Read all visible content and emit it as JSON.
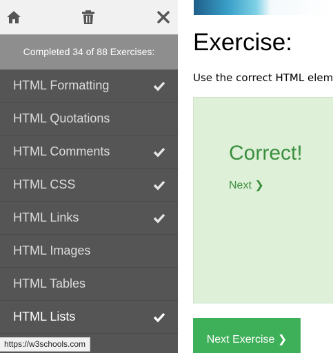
{
  "sidebar": {
    "progress_text": "Completed 34 of 88 Exercises:",
    "items": [
      {
        "label": "HTML Formatting",
        "checked": true
      },
      {
        "label": "HTML Quotations",
        "checked": false
      },
      {
        "label": "HTML Comments",
        "checked": true
      },
      {
        "label": "HTML CSS",
        "checked": true
      },
      {
        "label": "HTML Links",
        "checked": true
      },
      {
        "label": "HTML Images",
        "checked": false
      },
      {
        "label": "HTML Tables",
        "checked": false
      },
      {
        "label": "HTML Lists",
        "checked": true
      }
    ],
    "icons": {
      "home": "home-icon",
      "trash": "trash-icon",
      "close": "close-icon",
      "check": "check-icon"
    }
  },
  "main": {
    "title": "Exercise:",
    "description": "Use the correct HTML elem",
    "result": {
      "message": "Correct!",
      "next_link": "Next ❯"
    },
    "next_button": "Next Exercise ❯"
  },
  "status_url": "https://w3schools.com",
  "colors": {
    "sidebar_bg": "#555555",
    "progress_bg": "#8e8e8e",
    "success_green": "#3fb05a",
    "correct_text": "#3a8f3e",
    "result_bg": "#dff0d8"
  }
}
